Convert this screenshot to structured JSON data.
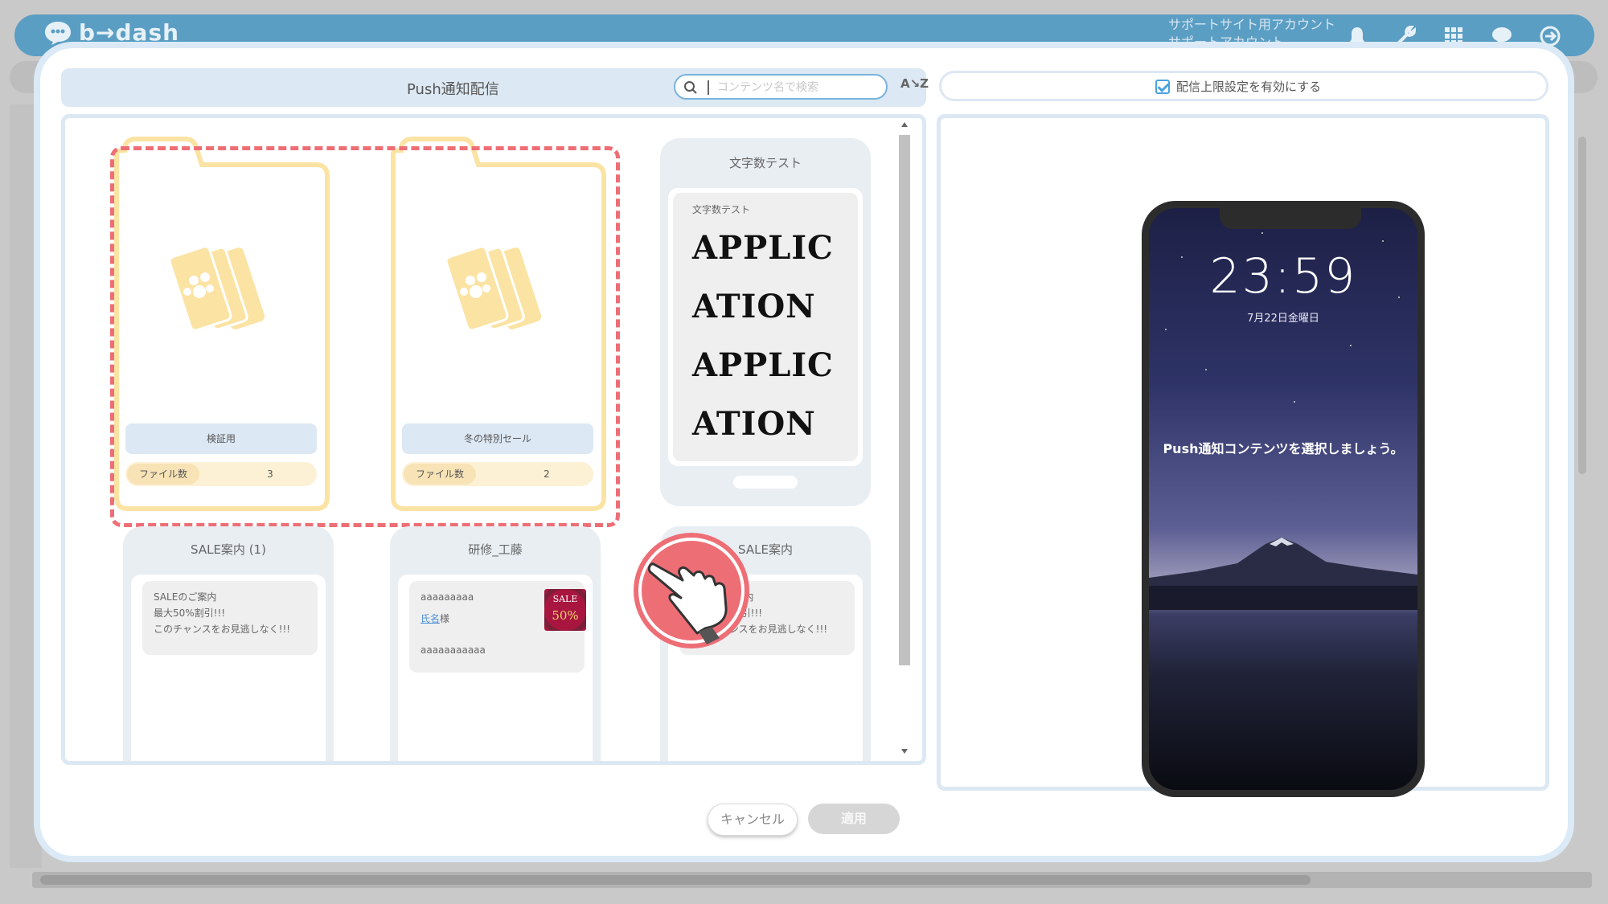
{
  "app": {
    "logo_text": "b→dash",
    "account_line1": "サポートサイト用アカウント",
    "account_line2": "サポートアカウント"
  },
  "modal": {
    "title": "Push通知配信",
    "search_placeholder": "コンテンツ名で検索",
    "sort_label": "A↘Z",
    "limit_checkbox_label": "配信上限設定を有効にする",
    "limit_checked": true
  },
  "folders": [
    {
      "name": "検証用",
      "count_label": "ファイル数",
      "count": "3"
    },
    {
      "name": "冬の特別セール",
      "count_label": "ファイル数",
      "count": "2"
    }
  ],
  "cards": {
    "char_test": {
      "title": "文字数テスト",
      "inner_title": "文字数テスト",
      "lines": [
        "APPLIC",
        "ATION",
        "APPLIC",
        "ATION"
      ]
    },
    "sale1": {
      "title": "SALE案内 (1)",
      "line1": "SALEのご案内",
      "line2": "最大50%割引!!!",
      "line3": "このチャンスをお見逃しなく!!!"
    },
    "kenshu": {
      "title": "研修_工藤",
      "line1": "aaaaaaaaa",
      "link": "氏名",
      "suffix": "様",
      "line3": "aaaaaaaaaaa",
      "thumb_top": "SALE",
      "thumb_bottom": "50%"
    },
    "sale2": {
      "title": "SALE案内",
      "line1": "SALEのご案内",
      "line2": "最大50%割引!!!",
      "line3": "このチャンスをお見逃しなく!!!"
    }
  },
  "preview": {
    "time": "23:59",
    "date": "7月22日金曜日",
    "message": "Push通知コンテンツを選択しましょう。"
  },
  "buttons": {
    "cancel": "キャンセル",
    "apply": "適用"
  },
  "colors": {
    "header": "#5b9ec4",
    "panel": "#dce8f3",
    "folder": "#fbe3a3",
    "selection": "#ee6e76",
    "checkbox": "#4aa3df"
  }
}
